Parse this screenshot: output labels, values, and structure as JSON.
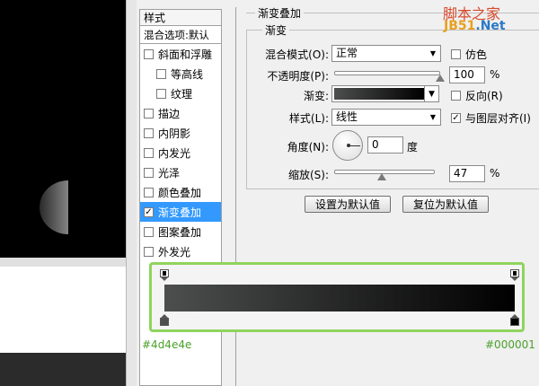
{
  "styles_panel": {
    "header": "样式",
    "blend_default": "混合选项:默认",
    "items": [
      {
        "label": "斜面和浮雕",
        "checked": false,
        "indent": false,
        "selected": false
      },
      {
        "label": "等高线",
        "checked": false,
        "indent": true,
        "selected": false
      },
      {
        "label": "纹理",
        "checked": false,
        "indent": true,
        "selected": false
      },
      {
        "label": "描边",
        "checked": false,
        "indent": false,
        "selected": false
      },
      {
        "label": "内阴影",
        "checked": false,
        "indent": false,
        "selected": false
      },
      {
        "label": "内发光",
        "checked": false,
        "indent": false,
        "selected": false
      },
      {
        "label": "光泽",
        "checked": false,
        "indent": false,
        "selected": false
      },
      {
        "label": "颜色叠加",
        "checked": false,
        "indent": false,
        "selected": false
      },
      {
        "label": "渐变叠加",
        "checked": true,
        "indent": false,
        "selected": true
      },
      {
        "label": "图案叠加",
        "checked": false,
        "indent": false,
        "selected": false
      },
      {
        "label": "外发光",
        "checked": false,
        "indent": false,
        "selected": false
      }
    ]
  },
  "dialog": {
    "group_title": "渐变叠加",
    "sub_title": "渐变",
    "blend_mode_label": "混合模式(O):",
    "blend_mode_value": "正常",
    "dither_label": "仿色",
    "opacity_label": "不透明度(P):",
    "opacity_value": "100",
    "opacity_unit": "%",
    "opacity_fraction": 1.0,
    "gradient_label": "渐变:",
    "reverse_label": "反向(R)",
    "style_label": "样式(L):",
    "style_value": "线性",
    "align_label": "与图层对齐(I)",
    "angle_label": "角度(N):",
    "angle_value": "0",
    "angle_unit": "度",
    "scale_label": "缩放(S):",
    "scale_value": "47",
    "scale_unit": "%",
    "scale_fraction": 0.47,
    "set_default_btn": "设置为默认值",
    "reset_default_btn": "复位为默认值"
  },
  "watermark": {
    "line1": "脚本之家",
    "line2_a": "JB51",
    "line2_b": ".Net"
  },
  "gradient_editor": {
    "start_color": "#4d4e4e",
    "end_color": "#000001",
    "start_hex_label": "#4d4e4e",
    "end_hex_label": "#000001"
  },
  "colors": {
    "highlight": "#3399ff",
    "editor_border": "#8fd45e",
    "hex_text": "#4aa02a"
  }
}
